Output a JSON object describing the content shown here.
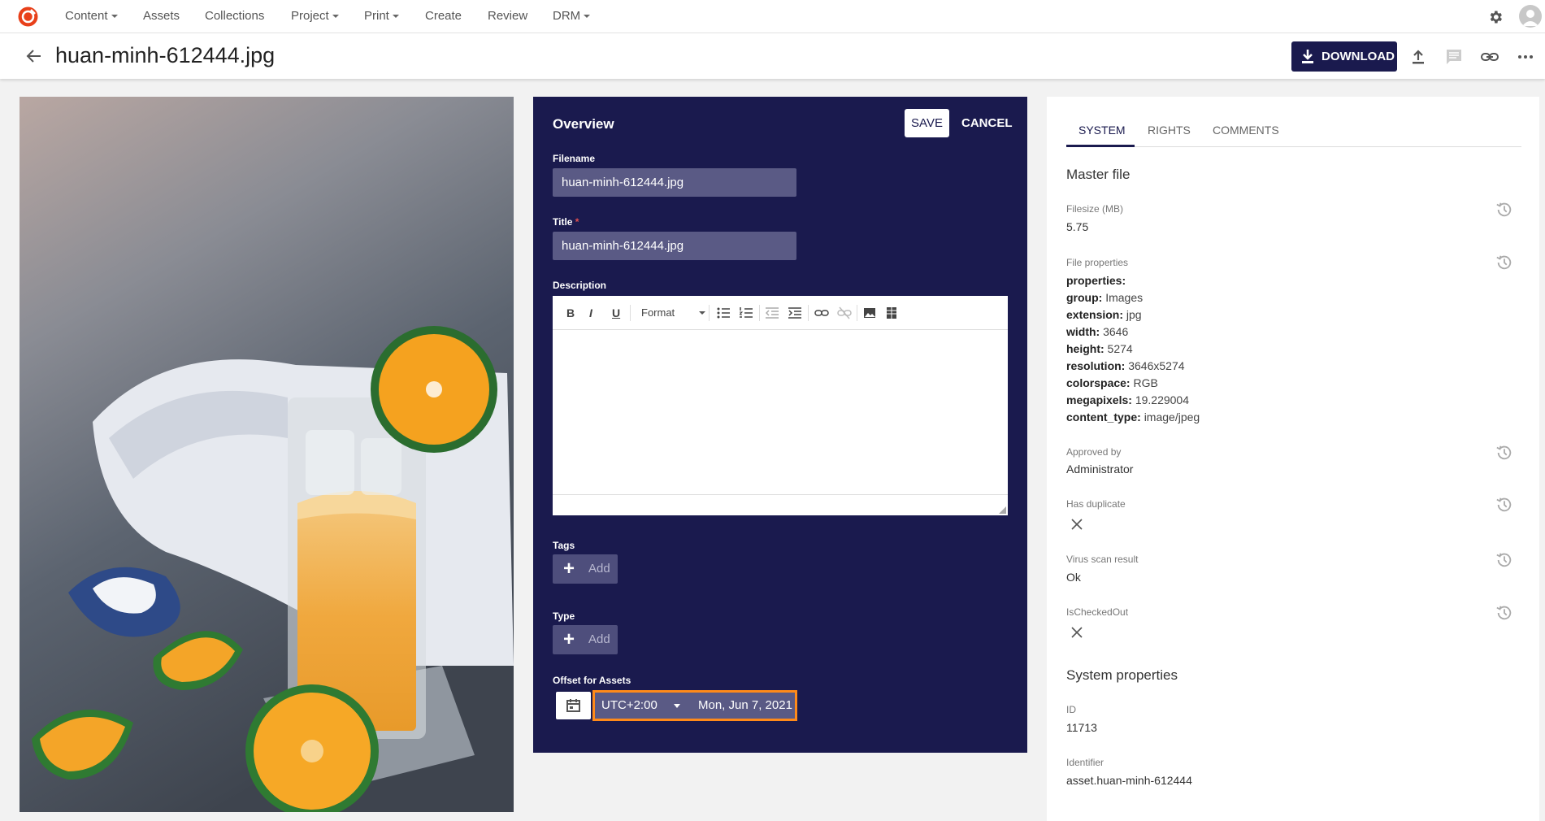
{
  "nav": {
    "items": [
      {
        "label": "Content",
        "dropdown": true
      },
      {
        "label": "Assets",
        "dropdown": false
      },
      {
        "label": "Collections",
        "dropdown": false
      },
      {
        "label": "Project",
        "dropdown": true
      },
      {
        "label": "Print",
        "dropdown": true
      },
      {
        "label": "Create",
        "dropdown": false
      },
      {
        "label": "Review",
        "dropdown": false
      },
      {
        "label": "DRM",
        "dropdown": true
      }
    ],
    "brand_color": "#e8401a"
  },
  "header": {
    "title": "huan-minh-612444.jpg",
    "download_label": "DOWNLOAD",
    "accent": "#1a1a4e"
  },
  "overview": {
    "title": "Overview",
    "save_label": "SAVE",
    "cancel_label": "CANCEL",
    "filename_label": "Filename",
    "filename_value": "huan-minh-612444.jpg",
    "title_label": "Title",
    "required_mark": "*",
    "title_value": "huan-minh-612444.jpg",
    "description_label": "Description",
    "editor": {
      "bold": "B",
      "italic": "I",
      "underline": "U",
      "format_label": "Format"
    },
    "tags_label": "Tags",
    "type_label": "Type",
    "add_label": "Add",
    "offset_label": "Offset for Assets",
    "timezone": "UTC+2:00",
    "date": "Mon, Jun 7, 2021"
  },
  "side": {
    "tabs": [
      "SYSTEM",
      "RIGHTS",
      "COMMENTS"
    ],
    "active_tab": "SYSTEM",
    "master_file_title": "Master file",
    "filesize_label": "Filesize (MB)",
    "filesize_value": "5.75",
    "file_props_label": "File properties",
    "file_props": {
      "header": "properties:",
      "group_k": "group:",
      "group_v": "Images",
      "ext_k": "extension:",
      "ext_v": "jpg",
      "width_k": "width:",
      "width_v": "3646",
      "height_k": "height:",
      "height_v": "5274",
      "res_k": "resolution:",
      "res_v": "3646x5274",
      "cs_k": "colorspace:",
      "cs_v": "RGB",
      "mp_k": "megapixels:",
      "mp_v": "19.229004",
      "ct_k": "content_type:",
      "ct_v": "image/jpeg"
    },
    "approved_label": "Approved by",
    "approved_value": "Administrator",
    "dup_label": "Has duplicate",
    "virus_label": "Virus scan result",
    "virus_value": "Ok",
    "checked_label": "IsCheckedOut",
    "system_props_title": "System properties",
    "id_label": "ID",
    "id_value": "11713",
    "identifier_label": "Identifier",
    "identifier_value": "asset.huan-minh-612444"
  }
}
